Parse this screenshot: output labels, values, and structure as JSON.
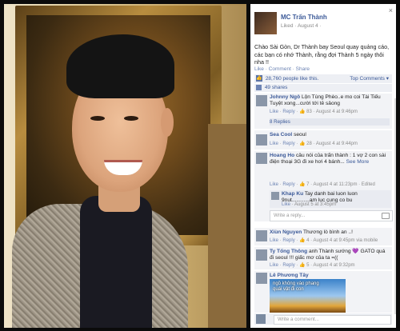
{
  "post": {
    "poster_name": "MC Trấn Thành",
    "poster_meta": "Liked · August 4 ·",
    "status_text": "Chào Sài Gòn, Dr Thành bay Seoul quay quảng cáo, các bạn có nhớ Thành, rằng đợi Thành 5 ngày thôi nha !!",
    "actions": "Like · Comment · Share",
    "likes_text": "28,760 people like this.",
    "top_comments": "Top Comments ▾",
    "shares_text": "49 shares",
    "close": "×"
  },
  "comments": [
    {
      "name": "Johnny Ngô",
      "text": "Lộn Tùng Phèo..e mo coi Tài Tiếu Tuyệt xong...cười tới tê sảong",
      "meta_like": "Like",
      "meta_reply": "Reply",
      "meta_rest": "· 👍 83 · August 4 at 9:46pm"
    },
    {
      "name": "Sea Cool",
      "text": "seoul",
      "meta_like": "Like",
      "meta_reply": "Reply",
      "meta_rest": "· 👍 28 · August 4 at 9:44pm"
    },
    {
      "name": "Hoang Ho",
      "text": "câu nói của trấn thành : 1 vợ 2 con sài điện thoại 3G đi xe hơi 4 bánh...",
      "see_more": "See More",
      "meta_like": "Like",
      "meta_reply": "Reply",
      "meta_rest": "· 👍 7 · August 4 at 11:23pm · Edited"
    },
    {
      "name": "Xiùn Nguyen",
      "text": "Thương lò bình an ..!",
      "meta_like": "Like",
      "meta_reply": "Reply",
      "meta_rest": "· 👍 4 · August 4 at 9:45pm via mobile"
    },
    {
      "name": "Ty Tống Thông",
      "text": "anh Thành sướng 💜 GATO quá đi seoul !!! giấc mơ của ta =((",
      "meta_like": "Like",
      "meta_reply": "Reply",
      "meta_rest": "· 👍 5 · August 4 at 9:32pm"
    },
    {
      "name": "Lê Phương Tây",
      "text": "",
      "meta_like": "",
      "meta_reply": "",
      "meta_rest": ""
    }
  ],
  "replies_link": "8 Replies",
  "reply": {
    "name": "Khap Ku",
    "text": "Tay danh bai luon luon 9nut............am luc cung co bu",
    "meta_like": "Like",
    "meta_rest": "· August 5 at 3:45pm"
  },
  "write_reply_placeholder": "Write a reply...",
  "write_comment_placeholder": "Write a comment...",
  "image_caption": "ngồ không vào phang quái vật đi con",
  "colors": {
    "fb_blue": "#3b5998",
    "link": "#6d84b4",
    "bg_gray": "#edeff4"
  }
}
